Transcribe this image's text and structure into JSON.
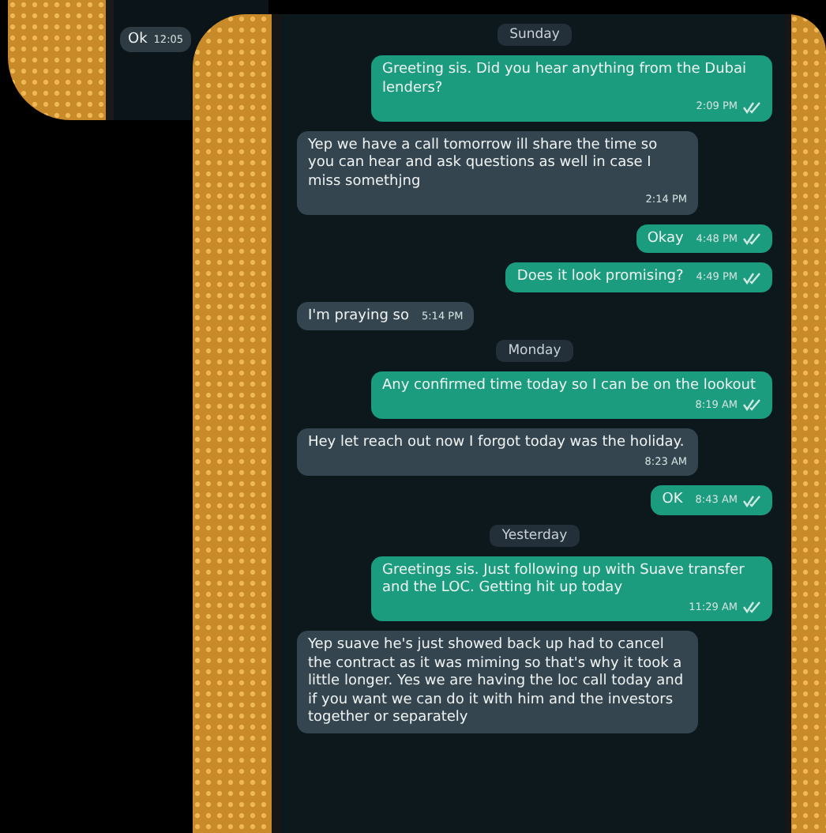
{
  "background_chat": {
    "messages": [
      {
        "text": "Ok",
        "time": "12:05"
      }
    ]
  },
  "messages": [
    {
      "kind": "date",
      "text": "Sunday"
    },
    {
      "kind": "out",
      "text": "Greeting sis. Did you hear anything from the Dubai lenders?",
      "time": "2:09 PM",
      "read": true
    },
    {
      "kind": "in",
      "text": "Yep we have a call tomorrow ill share the time so you can hear and ask questions as well in case I miss somethjng",
      "time": "2:14 PM"
    },
    {
      "kind": "out",
      "text": "Okay",
      "time": "4:48 PM",
      "read": true
    },
    {
      "kind": "out",
      "text": "Does it look promising?",
      "time": "4:49 PM",
      "read": true
    },
    {
      "kind": "in",
      "text": "I'm praying so",
      "time": "5:14 PM"
    },
    {
      "kind": "date",
      "text": "Monday"
    },
    {
      "kind": "out",
      "text": "Any confirmed time today so I can be on the lookout",
      "time": "8:19 AM",
      "read": true
    },
    {
      "kind": "in",
      "text": "Hey let reach out now I forgot today was the holiday.",
      "time": "8:23 AM"
    },
    {
      "kind": "out",
      "text": "OK",
      "time": "8:43 AM",
      "read": true
    },
    {
      "kind": "date",
      "text": "Yesterday"
    },
    {
      "kind": "out",
      "text": "Greetings sis. Just following up with Suave transfer and the LOC. Getting hit up today",
      "time": "11:29 AM",
      "read": true
    },
    {
      "kind": "in",
      "text": "Yep suave he's just showed back up had to cancel the contract as it was miming so that's why it took a little longer.  Yes we are having the loc call today and if you want we can do it with him and the investors together or separately"
    }
  ]
}
